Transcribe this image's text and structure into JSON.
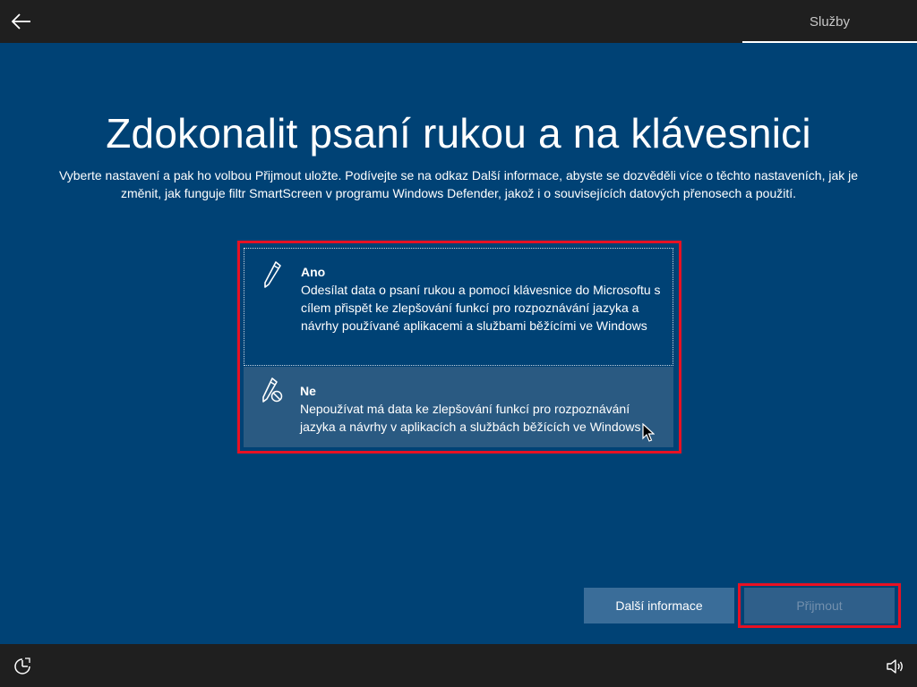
{
  "header": {
    "step_label": "Služby"
  },
  "main": {
    "title": "Zdokonalit psaní rukou a na klávesnici",
    "description": "Vyberte nastavení a pak ho volbou Přijmout uložte. Podívejte se na odkaz Další informace, abyste se dozvěděli více o těchto nastaveních, jak je změnit, jak funguje filtr SmartScreen v programu Windows Defender, jakož i o souvisejících datových přenosech a použití.",
    "options": [
      {
        "title": "Ano",
        "body": "Odesílat data o psaní rukou a pomocí klávesnice do Microsoftu s cílem přispět ke zlepšování funkcí pro rozpoznávání jazyka a návrhy používané aplikacemi a službami běžícími ve Windows",
        "icon": "pen-icon"
      },
      {
        "title": "Ne",
        "body": "Nepoužívat má data ke zlepšování funkcí pro rozpoznávání jazyka a návrhy v aplikacích a službách běžících ve Windows",
        "icon": "pen-blocked-icon"
      }
    ]
  },
  "buttons": {
    "more_info": "Další informace",
    "accept": "Přijmout"
  },
  "colors": {
    "background": "#004275",
    "bar": "#1f1f1f",
    "highlight": "#e81123"
  }
}
